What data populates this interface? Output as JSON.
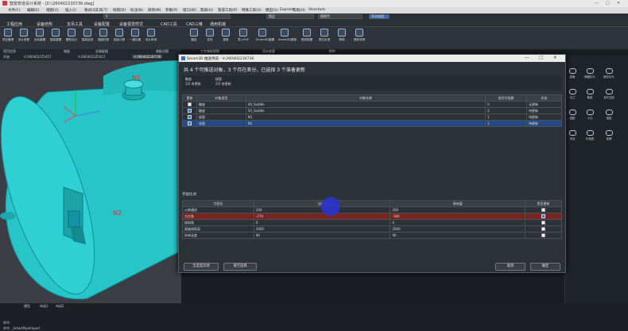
{
  "app": {
    "title": "智能管道设计系统 - [D:\\260402230736.dwg]"
  },
  "menus": [
    "文件(F)",
    "编辑(E)",
    "视图(V)",
    "插入(I)",
    "格式(O)",
    "工具(T)",
    "绘图(D)",
    "标注(N)",
    "修改(M)",
    "参数(P)",
    "窗口(W)",
    "帮助(H)",
    "管道工具(P)",
    "特殊工具(U)",
    "模型(G)",
    "Express",
    "帮助(H)",
    "Structure"
  ],
  "quickbar": {
    "layer_value": "0",
    "style_value": "随层",
    "color_value": "随颜色",
    "draw_label": "开启绘图"
  },
  "ribbon_tabs": [
    "工程应用",
    "设备结构",
    "支吊工具",
    "设备配置",
    "设备视觉样式",
    "CAD工具",
    "CAD三维",
    "通用机械"
  ],
  "ribbon_buttons": [
    "项目管理",
    "设计参数",
    "自动建模",
    "智能建模",
    "模型设计",
    "智能检查",
    "强度校核",
    "绕曲计算",
    "一键出图",
    "设计审查",
    "图纸",
    "发布",
    "更新",
    "导入PVE",
    "Smart3D建模",
    "Smart3D更新",
    "规则配置",
    "提交反馈",
    "帮助",
    "更新说明"
  ],
  "doc_tabs": {
    "row1": [
      "项目信息",
      "装配",
      "总装配图",
      "装配详图",
      "工艺装配视图",
      "设计变更",
      "附件"
    ],
    "row2": [
      "开始",
      "V-260402225457",
      "V-260402225457",
      "V-260402230736"
    ]
  },
  "labels_3d": {
    "n1": "N1",
    "n2": "N2"
  },
  "dialog": {
    "title": "Smart3D 推送预览 - V-260402230736",
    "summary": "共 4 个可推送对象，3 个存在差分，已选择 3 个准备更新",
    "stats": [
      {
        "label": "鞍座",
        "value": "1/2 有更新"
      },
      {
        "label": "接管",
        "value": "2/2 有更新"
      }
    ],
    "table_headers": [
      "更新",
      "对象类型",
      "对象名称",
      "差异字段数",
      "状态"
    ],
    "rows": [
      {
        "checked": false,
        "type": "鞍座",
        "name": "49_Saddle",
        "diff": "0",
        "status": "无更新"
      },
      {
        "checked": true,
        "type": "鞍座",
        "name": "50_Saddle",
        "diff": "2",
        "status": "待更新"
      },
      {
        "checked": true,
        "type": "接管",
        "name": "N1",
        "diff": "1",
        "status": "待更新"
      },
      {
        "checked": true,
        "type": "接管",
        "name": "N2",
        "diff": "1",
        "status": "待更新"
      }
    ],
    "field_title": "字段比对",
    "field_headers": [
      "字段名",
      "当前值",
      "原始值",
      "是否更新"
    ],
    "field_rows": [
      {
        "field": "公称通径",
        "current": "200",
        "original": "200",
        "update": false
      },
      {
        "field": "方位角",
        "current": "-270",
        "original": "-180",
        "update": true
      },
      {
        "field": "倾斜角",
        "current": "0",
        "original": "0",
        "update": false
      },
      {
        "field": "离轴线距离",
        "current": "2000",
        "original": "2000",
        "update": false
      },
      {
        "field": "外伸长度",
        "current": "90",
        "original": "90",
        "update": false
      }
    ],
    "buttons": {
      "select_all_diff": "全选差异项",
      "clear": "清空选择",
      "cancel": "取消",
      "ok": "确定"
    }
  },
  "right_panel": {
    "items": [
      "接管",
      "椭圆封头",
      "碟形封头",
      "法兰",
      "鞍座",
      "耳式支座",
      "裙座",
      "人孔",
      "裙座",
      "吊耳",
      "补强圈",
      "铭牌",
      "包括",
      "梯子平台",
      "保温"
    ]
  },
  "command": {
    "tabs": [
      "模型",
      "布局1",
      "布局2"
    ],
    "lines": [
      "命令:",
      "命令: _SmartPipeImport"
    ]
  },
  "colors": {
    "vessel": "#27c4c8",
    "accent": "#3d6fb5",
    "selected_row": "#244a85",
    "changed_row": "#7a2323"
  }
}
